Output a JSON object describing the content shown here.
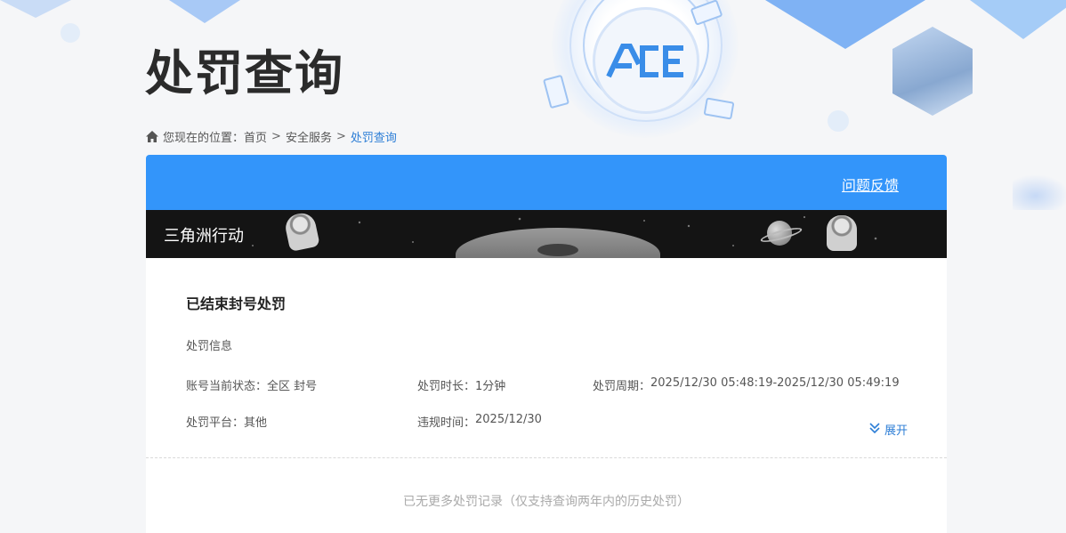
{
  "header": {
    "title": "处罚查询"
  },
  "breadcrumb": {
    "prefix": "您现在的位置：",
    "items": [
      "首页",
      "安全服务",
      "处罚查询"
    ],
    "separator": ">"
  },
  "card": {
    "feedback_label": "问题反馈",
    "game_name": "三角洲行动",
    "record": {
      "title": "已结束封号处罚",
      "section_label": "处罚信息",
      "fields": [
        {
          "label": "账号当前状态：",
          "value": "全区 封号"
        },
        {
          "label": "处罚时长：",
          "value": "1分钟"
        },
        {
          "label": "处罚周期：",
          "value": "2025/12/30 05:48:19-2025/12/30 05:49:19"
        },
        {
          "label": "处罚平台：",
          "value": "其他"
        },
        {
          "label": "违规时间：",
          "value": "2025/12/30"
        }
      ],
      "expand_label": "展开"
    },
    "no_more_text": "已无更多处罚记录（仅支持查询两年内的历史处罚）"
  },
  "colors": {
    "accent": "#3395fa",
    "link": "#2d7ed6"
  },
  "icons": [
    "home-icon",
    "double-chevron-down-icon"
  ]
}
